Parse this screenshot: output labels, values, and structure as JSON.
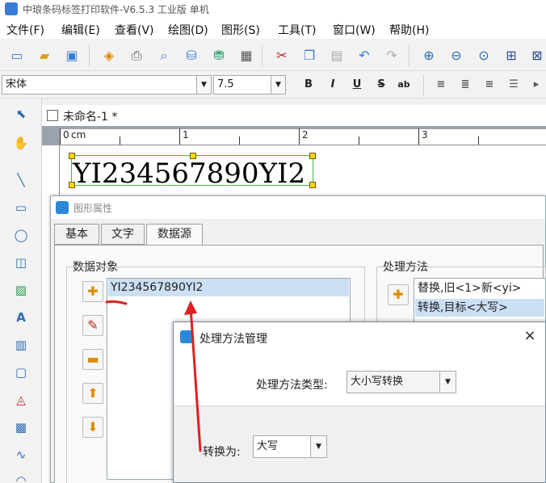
{
  "app": {
    "title": "中琅条码标签打印软件-V6.5.3 工业版 单机"
  },
  "menu": [
    "文件(F)",
    "编辑(E)",
    "查看(V)",
    "绘图(D)",
    "图形(S)",
    "工具(T)",
    "窗口(W)",
    "帮助(H)"
  ],
  "format": {
    "font": "宋体",
    "size": "7.5",
    "bold": "B",
    "italic": "I",
    "underline": "U",
    "strike": "S",
    "wrap": "ab"
  },
  "document": {
    "tab": "未命名-1 *"
  },
  "ruler": {
    "labels": [
      "0",
      "cm",
      "1",
      "2",
      "3"
    ]
  },
  "label": {
    "barcode_text": "YI234567890YI2"
  },
  "props_dialog": {
    "title": "图形属性",
    "tabs": [
      "基本",
      "文字",
      "数据源"
    ],
    "active_tab": "数据源",
    "data_objects_label": "数据对象",
    "data_objects": [
      "YI234567890YI2"
    ],
    "methods_label": "处理方法",
    "methods": [
      "替换,旧<1>新<yi>",
      "转换,目标<大写>"
    ]
  },
  "method_dialog": {
    "title": "处理方法管理",
    "type_label": "处理方法类型:",
    "type_value": "大小写转换",
    "convert_label": "转换为:",
    "convert_value": "大写",
    "close": "×"
  },
  "colors": {
    "accent": "#2b88d8",
    "annotation": "#e02020",
    "selection": "#cce0f5",
    "handle": "#ffd800"
  }
}
